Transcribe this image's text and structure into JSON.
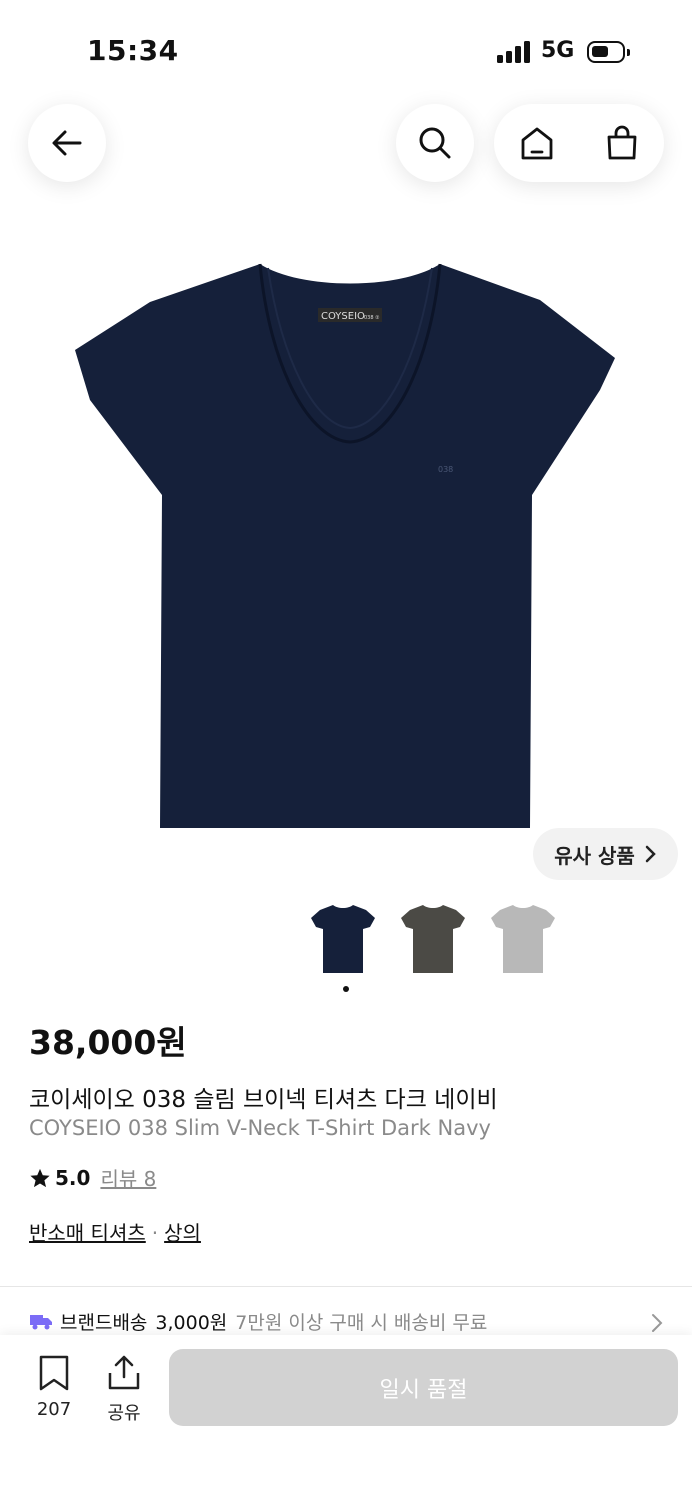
{
  "status_bar": {
    "time": "15:34",
    "network": "5G"
  },
  "nav": {
    "back_icon": "arrow-left-icon",
    "search_icon": "search-icon",
    "home_icon": "home-icon",
    "bag_icon": "shopping-bag-icon"
  },
  "product": {
    "image_logo_text": "COYSEIO",
    "image_logo_sub": "038 ②",
    "image_chest_text": "038",
    "similar_label": "유사 상품",
    "thumbnails": [
      {
        "name": "navy",
        "color": "#15203a"
      },
      {
        "name": "charcoal",
        "color": "#4b4a45"
      },
      {
        "name": "gray",
        "color": "#b8b8b8"
      }
    ],
    "price": "38,000원",
    "name_ko": "코이세이오 038 슬림 브이넥 티셔츠 다크 네이비",
    "name_en": "COYSEIO 038 Slim V-Neck T-Shirt Dark Navy",
    "rating": "5.0",
    "review_label": "리뷰 8",
    "category_1": "반소매 티셔츠",
    "category_sep": "·",
    "category_2": "상의"
  },
  "shipping": {
    "brand_label": "브랜드배송",
    "fee": "3,000원",
    "note": "7만원 이상 구매 시 배송비 무료"
  },
  "bottom_bar": {
    "bookmark_count": "207",
    "share_label": "공유",
    "soldout_label": "일시 품절"
  }
}
